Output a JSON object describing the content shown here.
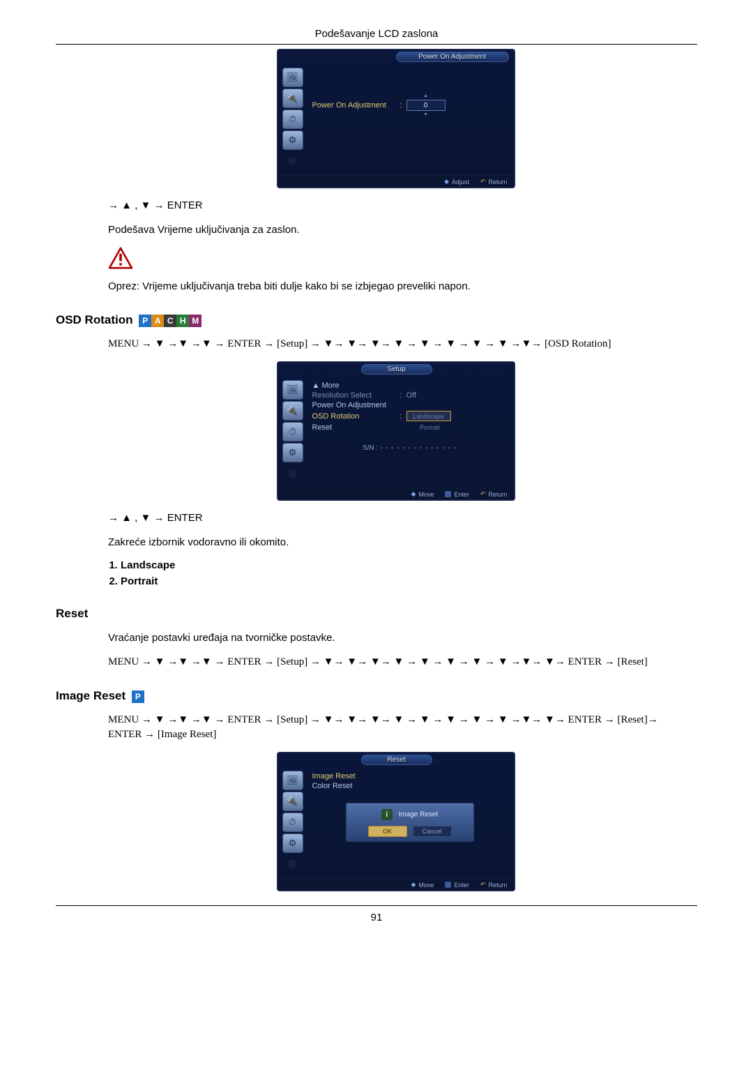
{
  "header": {
    "title": "Podešavanje LCD zaslona"
  },
  "osd1": {
    "title": "Power On Adjustment",
    "row_label": "Power On Adjustment",
    "sep": ":",
    "value": "0",
    "hints": {
      "adjust": "Adjust",
      "return": "Return"
    }
  },
  "nav1": "→ ▲ , ▼ → ENTER",
  "p1": "Podešava Vrijeme uključivanja za zaslon.",
  "p2": "Oprez: Vrijeme uključivanja treba biti dulje kako bi se izbjegao preveliki napon.",
  "sec_osd_rotation": {
    "heading": "OSD Rotation",
    "nav_line": "MENU → ▼ →▼ →▼ → ENTER → [Setup] → ▼→ ▼→ ▼→ ▼ → ▼ → ▼ → ▼ → ▼ →▼→ [OSD Rotation]"
  },
  "osd2": {
    "title": "Setup",
    "rows": {
      "more": "▲ More",
      "res_label": "Resolution Select",
      "res_sep": ":",
      "res_val": "Off",
      "poa": "Power On Adjustment",
      "osdrot_label": "OSD Rotation",
      "osdrot_sep": ":",
      "opt_landscape": "Landscape",
      "opt_portrait": "Portrait",
      "reset": "Reset",
      "sn_label": "S/N :",
      "sn_val": "- - - - - - - - - - - - - -"
    },
    "hints": {
      "move": "Move",
      "enter": "Enter",
      "return": "Return"
    }
  },
  "nav2": "→ ▲ , ▼ → ENTER",
  "p3": "Zakreće izbornik vodoravno ili okomito.",
  "list": {
    "i1": "Landscape",
    "i2": "Portrait"
  },
  "sec_reset": {
    "heading": "Reset",
    "p": "Vraćanje postavki uređaja na tvorničke postavke.",
    "nav_line": "MENU → ▼ →▼ →▼ → ENTER → [Setup] → ▼→ ▼→ ▼→ ▼ → ▼ → ▼ → ▼ → ▼ →▼→ ▼→ ENTER → [Reset]"
  },
  "sec_image_reset": {
    "heading": "Image Reset",
    "nav_line": "MENU → ▼ →▼ →▼ → ENTER → [Setup] → ▼→ ▼→ ▼→ ▼ → ▼ → ▼ → ▼ → ▼ →▼→ ▼→ ENTER → [Reset]→ ENTER → [Image Reset]"
  },
  "osd3": {
    "title": "Reset",
    "rows": {
      "image_reset": "Image Reset",
      "color_reset": "Color Reset"
    },
    "modal": {
      "title": "Image Reset",
      "ok": "OK",
      "cancel": "Cancel"
    },
    "hints": {
      "move": "Move",
      "enter": "Enter",
      "return": "Return"
    }
  },
  "page_number": "91",
  "icons": {
    "osd_side": [
      "picture-icon",
      "input-icon",
      "clock-icon",
      "gear-icon",
      "multi-icon"
    ]
  },
  "mode_letters": {
    "p": "P",
    "a": "A",
    "c": "C",
    "h": "H",
    "m": "M"
  }
}
